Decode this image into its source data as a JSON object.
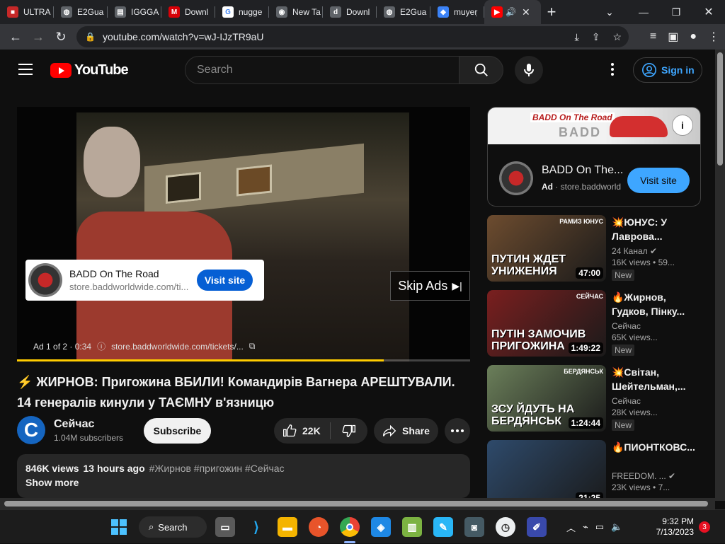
{
  "browser": {
    "tabs": [
      {
        "label": "ULTRA",
        "icon": "pdf-icon",
        "color": "#c62828",
        "glyph": "■"
      },
      {
        "label": "E2Gua",
        "icon": "globe-icon",
        "color": "#5f6368",
        "glyph": "◍"
      },
      {
        "label": "IGGGA",
        "icon": "document-icon",
        "color": "#5f6368",
        "glyph": "▤"
      },
      {
        "label": "Downl",
        "icon": "mega-icon",
        "color": "#d90007",
        "glyph": "M"
      },
      {
        "label": "nugge",
        "icon": "google-icon",
        "color": "#ffffff",
        "glyph": "G"
      },
      {
        "label": "New Ta",
        "icon": "chrome-icon",
        "color": "#5f6368",
        "glyph": "◉"
      },
      {
        "label": "Downl",
        "icon": "site-icon",
        "color": "#5f6368",
        "glyph": "d"
      },
      {
        "label": "E2Gua",
        "icon": "globe-icon",
        "color": "#5f6368",
        "glyph": "◍"
      },
      {
        "label": "muyeṛ",
        "icon": "app-icon",
        "color": "#3b82f6",
        "glyph": "◆"
      }
    ],
    "active_tab_icon": "youtube-icon",
    "url": "youtube.com/watch?v=wJ-IJzTR9aU"
  },
  "youtube": {
    "logo_text": "YouTube",
    "search_placeholder": "Search",
    "sign_in": "Sign in",
    "player": {
      "ad_overlay_title": "BADD On The Road",
      "ad_overlay_url": "store.baddworldwide.com/ti...",
      "ad_overlay_button": "Visit site",
      "skip_label": "Skip Ads",
      "ad_info": "Ad 1 of 2 · 0:34",
      "ad_link": "store.baddworldwide.com/tickets/...",
      "ad_progress": 0.81
    },
    "video": {
      "title": "⚡ ЖИРНОВ: Пригожина ВБИЛИ! Командирів Вагнера АРЕШТУВАЛИ. 14 генералів кинули у ТАЄМНУ в'язницю",
      "channel_initial": "C",
      "channel": "Сейчас",
      "subscribers": "1.04M subscribers",
      "subscribe_label": "Subscribe",
      "likes": "22K",
      "share_label": "Share",
      "views": "846K views",
      "time_ago": "13 hours ago",
      "tags": "#Жирнов #пригожин #Сейчас",
      "show_more": "Show more"
    },
    "side_ad": {
      "banner_title": "BADD On The Road",
      "banner_sub": "BADD",
      "name": "BADD On The...",
      "ad_label": "Ad",
      "domain": "store.baddworld",
      "button": "Visit site"
    },
    "recommendations": [
      {
        "title": "💥ЮНУС: У Лаврова...",
        "channel": "24 Канал",
        "verified": "✔",
        "views": "16K views",
        "age": "59...",
        "badge": "New",
        "duration": "47:00",
        "thumb_text": "ПУТИН ЖДЕТ УНИЖЕНИЯ",
        "thumb_tag": "РАМИЗ ЮНУС",
        "thumb_bg": "#6d4c2f"
      },
      {
        "title": "🔥Жирнов, Гудков, Пінку...",
        "channel": "Сейчас",
        "verified": "",
        "views": "65K views...",
        "age": "",
        "badge": "New",
        "duration": "1:49:22",
        "thumb_text": "ПУТІН ЗАМОЧИВ ПРИГОЖИНА",
        "thumb_tag": "СЕЙЧАС",
        "thumb_bg": "#7a1f1f"
      },
      {
        "title": "💥Світан, Шейтельман,...",
        "channel": "Сейчас",
        "verified": "",
        "views": "28K views...",
        "age": "",
        "badge": "New",
        "duration": "1:24:44",
        "thumb_text": "ЗСУ ЙДУТЬ НА БЕРДЯНСЬК",
        "thumb_tag": "БЕРДЯНСЬК",
        "thumb_bg": "#6b7f5a"
      },
      {
        "title": "🔥ПИОНТКОВС...",
        "channel": "FREEDOM. ...",
        "verified": "✔",
        "views": "23K views",
        "age": "7...",
        "badge": "",
        "duration": "21:25",
        "thumb_text": "",
        "thumb_tag": "",
        "thumb_bg": "#2e4a6b"
      }
    ]
  },
  "taskbar": {
    "search_label": "Search",
    "time": "9:32 PM",
    "date": "7/13/2023",
    "notifications": "3"
  }
}
